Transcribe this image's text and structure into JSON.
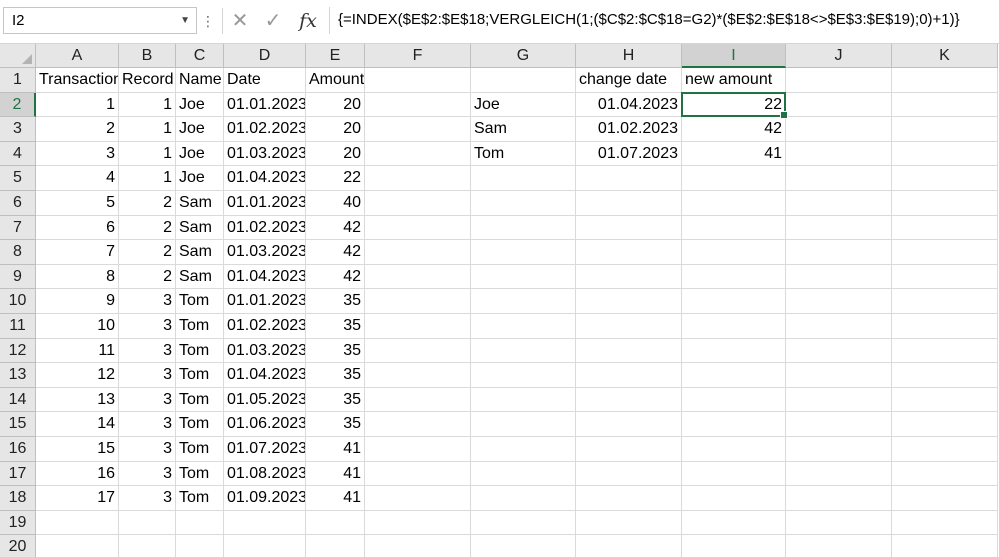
{
  "formula_bar": {
    "name_box": "I2",
    "formula": "{=INDEX($E$2:$E$18;VERGLEICH(1;($C$2:$C$18=G2)*($E$2:$E$18<>$E$3:$E$19);0)+1)}",
    "cancel_icon": "close-icon",
    "enter_icon": "check-icon",
    "fx_label": "fx"
  },
  "columns": [
    "A",
    "B",
    "C",
    "D",
    "E",
    "F",
    "G",
    "H",
    "I",
    "J",
    "K"
  ],
  "rows": [
    "1",
    "2",
    "3",
    "4",
    "5",
    "6",
    "7",
    "8",
    "9",
    "10",
    "11",
    "12",
    "13",
    "14",
    "15",
    "16",
    "17",
    "18",
    "19",
    "20"
  ],
  "headers": {
    "A": "Transaction",
    "B": "Record",
    "C": "Name",
    "D": "Date",
    "E": "Amount",
    "H": "change date",
    "I": "new amount"
  },
  "table": [
    {
      "transaction": "1",
      "record": "1",
      "name": "Joe",
      "date": "01.01.2023",
      "amount": "20"
    },
    {
      "transaction": "2",
      "record": "1",
      "name": "Joe",
      "date": "01.02.2023",
      "amount": "20"
    },
    {
      "transaction": "3",
      "record": "1",
      "name": "Joe",
      "date": "01.03.2023",
      "amount": "20"
    },
    {
      "transaction": "4",
      "record": "1",
      "name": "Joe",
      "date": "01.04.2023",
      "amount": "22"
    },
    {
      "transaction": "5",
      "record": "2",
      "name": "Sam",
      "date": "01.01.2023",
      "amount": "40"
    },
    {
      "transaction": "6",
      "record": "2",
      "name": "Sam",
      "date": "01.02.2023",
      "amount": "42"
    },
    {
      "transaction": "7",
      "record": "2",
      "name": "Sam",
      "date": "01.03.2023",
      "amount": "42"
    },
    {
      "transaction": "8",
      "record": "2",
      "name": "Sam",
      "date": "01.04.2023",
      "amount": "42"
    },
    {
      "transaction": "9",
      "record": "3",
      "name": "Tom",
      "date": "01.01.2023",
      "amount": "35"
    },
    {
      "transaction": "10",
      "record": "3",
      "name": "Tom",
      "date": "01.02.2023",
      "amount": "35"
    },
    {
      "transaction": "11",
      "record": "3",
      "name": "Tom",
      "date": "01.03.2023",
      "amount": "35"
    },
    {
      "transaction": "12",
      "record": "3",
      "name": "Tom",
      "date": "01.04.2023",
      "amount": "35"
    },
    {
      "transaction": "13",
      "record": "3",
      "name": "Tom",
      "date": "01.05.2023",
      "amount": "35"
    },
    {
      "transaction": "14",
      "record": "3",
      "name": "Tom",
      "date": "01.06.2023",
      "amount": "35"
    },
    {
      "transaction": "15",
      "record": "3",
      "name": "Tom",
      "date": "01.07.2023",
      "amount": "41"
    },
    {
      "transaction": "16",
      "record": "3",
      "name": "Tom",
      "date": "01.08.2023",
      "amount": "41"
    },
    {
      "transaction": "17",
      "record": "3",
      "name": "Tom",
      "date": "01.09.2023",
      "amount": "41"
    }
  ],
  "summary": [
    {
      "name": "Joe",
      "change_date": "01.04.2023",
      "new_amount": "22"
    },
    {
      "name": "Sam",
      "change_date": "01.02.2023",
      "new_amount": "42"
    },
    {
      "name": "Tom",
      "change_date": "01.07.2023",
      "new_amount": "41"
    }
  ],
  "selection": {
    "column": "I",
    "row": "2"
  },
  "colors": {
    "accent": "#217346",
    "header_bg": "#e6e6e6",
    "gridline": "#dadada"
  }
}
